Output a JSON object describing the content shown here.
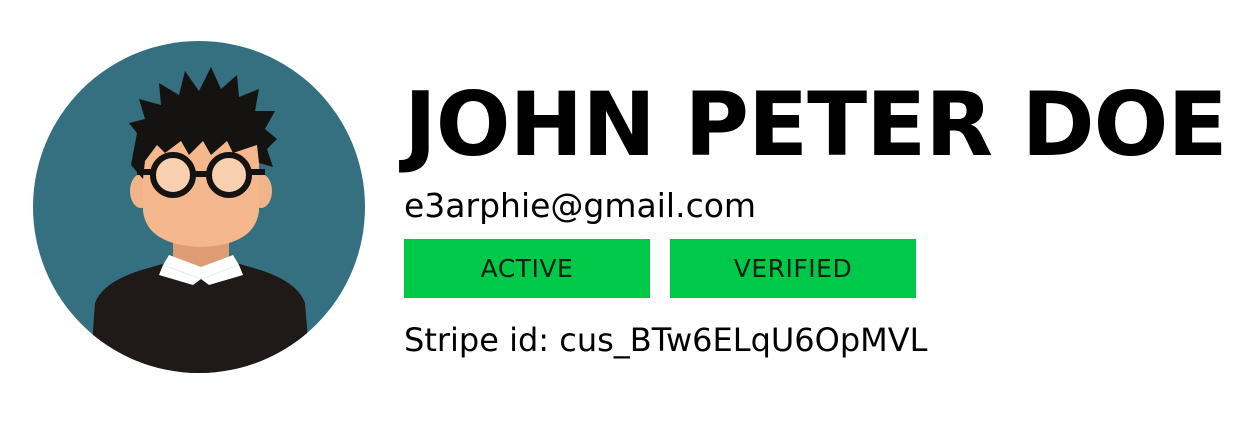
{
  "profile": {
    "name": "JOHN PETER DOE",
    "email": "e3arphie@gmail.com",
    "badges": [
      {
        "label": "ACTIVE",
        "color": "#00c94a"
      },
      {
        "label": "VERIFIED",
        "color": "#00c94a"
      }
    ],
    "stripe_id": "Stripe id: cus_BTw6ELqU6OpMVL",
    "avatar_icon": "male-avatar-with-glasses"
  },
  "colors": {
    "avatar_background": "#34707f",
    "badge_background": "#00c94a",
    "text": "#000000"
  }
}
